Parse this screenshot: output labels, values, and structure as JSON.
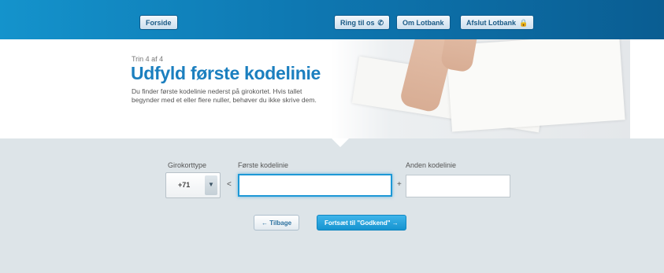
{
  "nav": {
    "home_label": "Forside",
    "call_label": "Ring til os",
    "call_icon": "phone-icon",
    "about_label": "Om Lotbank",
    "close_label": "Afslut Lotbank",
    "close_icon": "lock-icon"
  },
  "hero": {
    "step": "Trin 4 af 4",
    "title": "Udfyld første kodelinie",
    "description": "Du finder første kodelinie nederst på girokortet. Hvis tallet begynder med et eller flere nuller, behøver du ikke skrive dem."
  },
  "form": {
    "girokorttype_label": "Girokorttype",
    "girokorttype_value": "+71",
    "first_line_label": "Første kodelinie",
    "first_line_value": "",
    "second_line_label": "Anden kodelinie",
    "second_line_value": "",
    "sep_lt": "<",
    "sep_plus": "+"
  },
  "buttons": {
    "back_label": "← Tilbage",
    "next_label": "Fortsæt til \"Godkend\" →"
  },
  "colors": {
    "topbar": "#0e78b2",
    "accent": "#1b7fbf",
    "primary_button": "#1593d0"
  }
}
